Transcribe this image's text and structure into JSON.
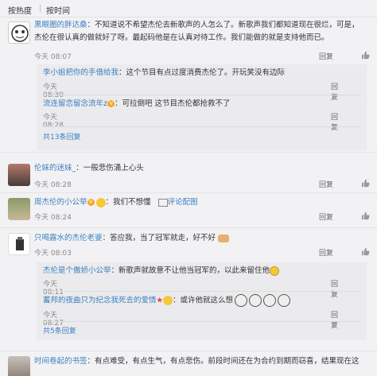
{
  "sortbar": {
    "hot": "按热度",
    "sep": "|",
    "time": "按时间"
  },
  "comments": [
    {
      "user": "黑眼圈的胖达桑",
      "text_line1": "：不知道说不希望杰伦去新歌声的人怎么了。新歌声我们都知道现在很烂，可是，",
      "text_line2": "杰伦在很认真的做就好了呀。最起码他是在认真对待工作。我们能做的就是支持他而已。",
      "time": "今天 08:07",
      "reply": "回复",
      "subs": [
        {
          "user": "李小姐把你的手借给我",
          "text": "：这个节目有点过度消费杰伦了。开玩笑没有边际",
          "time": "今天 08:30",
          "reply": "回复"
        },
        {
          "user": "流连留恋留念流年z",
          "text": "：可拉倒吧 这节目杰伦都抢救不了",
          "time": "今天 08:28",
          "reply": "回复"
        }
      ],
      "more": "共13条回复"
    },
    {
      "user": "伦妹的迷妹_",
      "text": "：一般悲伤涌上心头",
      "time": "今天 08:28",
      "reply": "回复"
    },
    {
      "user": "周杰伦的小公举",
      "text": "：我们不想懂",
      "time": "今天 08:24",
      "reply": "回复",
      "extra": "评论配图"
    },
    {
      "user": "只喝露水的杰伦老婆",
      "text": "：答应我，当了冠军就走，好不好",
      "time": "今天 08:03",
      "reply": "回复",
      "subs": [
        {
          "user": "杰伦是个傲娇小公举",
          "text": "：新歌声就故意不让他当冠军的，以此来留住他",
          "time": "今天 08:11",
          "reply": "回复"
        },
        {
          "user": "蓄邦的夜曲只为纪念我死去的爱情",
          "text": "：或许他就这么想",
          "time": "今天 08:27",
          "reply": "回复"
        }
      ],
      "more": "共5条回复"
    },
    {
      "user": "时间卷起的书签",
      "text": "：有点难受，有点生气，有点悲伤。前段时间还在为合约到期而窃喜，结果现在这"
    }
  ],
  "colors": {
    "link": "#3e7fbf",
    "background": "#f2f2f5",
    "subbox": "#ebebee"
  }
}
